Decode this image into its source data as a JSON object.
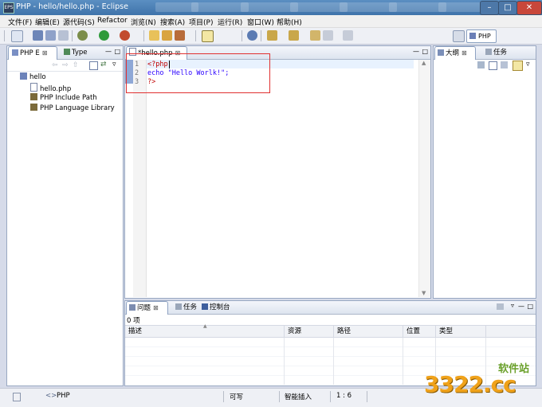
{
  "window": {
    "title": "PHP - hello/hello.php - Eclipse"
  },
  "menu": [
    "文件(F)",
    "编辑(E)",
    "源代码(S)",
    "Refactor",
    "浏览(N)",
    "搜索(A)",
    "项目(P)",
    "运行(R)",
    "窗口(W)",
    "帮助(H)"
  ],
  "perspective": {
    "label": "PHP"
  },
  "explorer": {
    "tabs": [
      "PHP E",
      "Type"
    ],
    "tree": {
      "project": "hello",
      "file": "hello.php",
      "include_path": "PHP Include Path",
      "library": "PHP Language Library"
    }
  },
  "editor": {
    "tab_label": "*hello.php",
    "lines": [
      {
        "num": "1",
        "text": "<?php"
      },
      {
        "num": "2",
        "text": "echo \"Hello Worlk!\";"
      },
      {
        "num": "3",
        "text": "?>"
      }
    ]
  },
  "outline": {
    "tabs": [
      "大纲",
      "任务"
    ]
  },
  "problems": {
    "tabs": [
      "问题",
      "任务",
      "控制台"
    ],
    "count_label": "0 项",
    "columns": [
      "描述",
      "资源",
      "路径",
      "位置",
      "类型"
    ]
  },
  "status": {
    "left": "PHP",
    "writable": "可写",
    "insert_mode": "智能插入",
    "position": "1 : 6"
  },
  "watermark": {
    "brand": "3322.cc",
    "caption": "软件站"
  },
  "colors": {
    "keyword": "#7f0055",
    "string": "#2a00ff",
    "php_tag": "#c00000",
    "selection_box": "#e03030"
  }
}
